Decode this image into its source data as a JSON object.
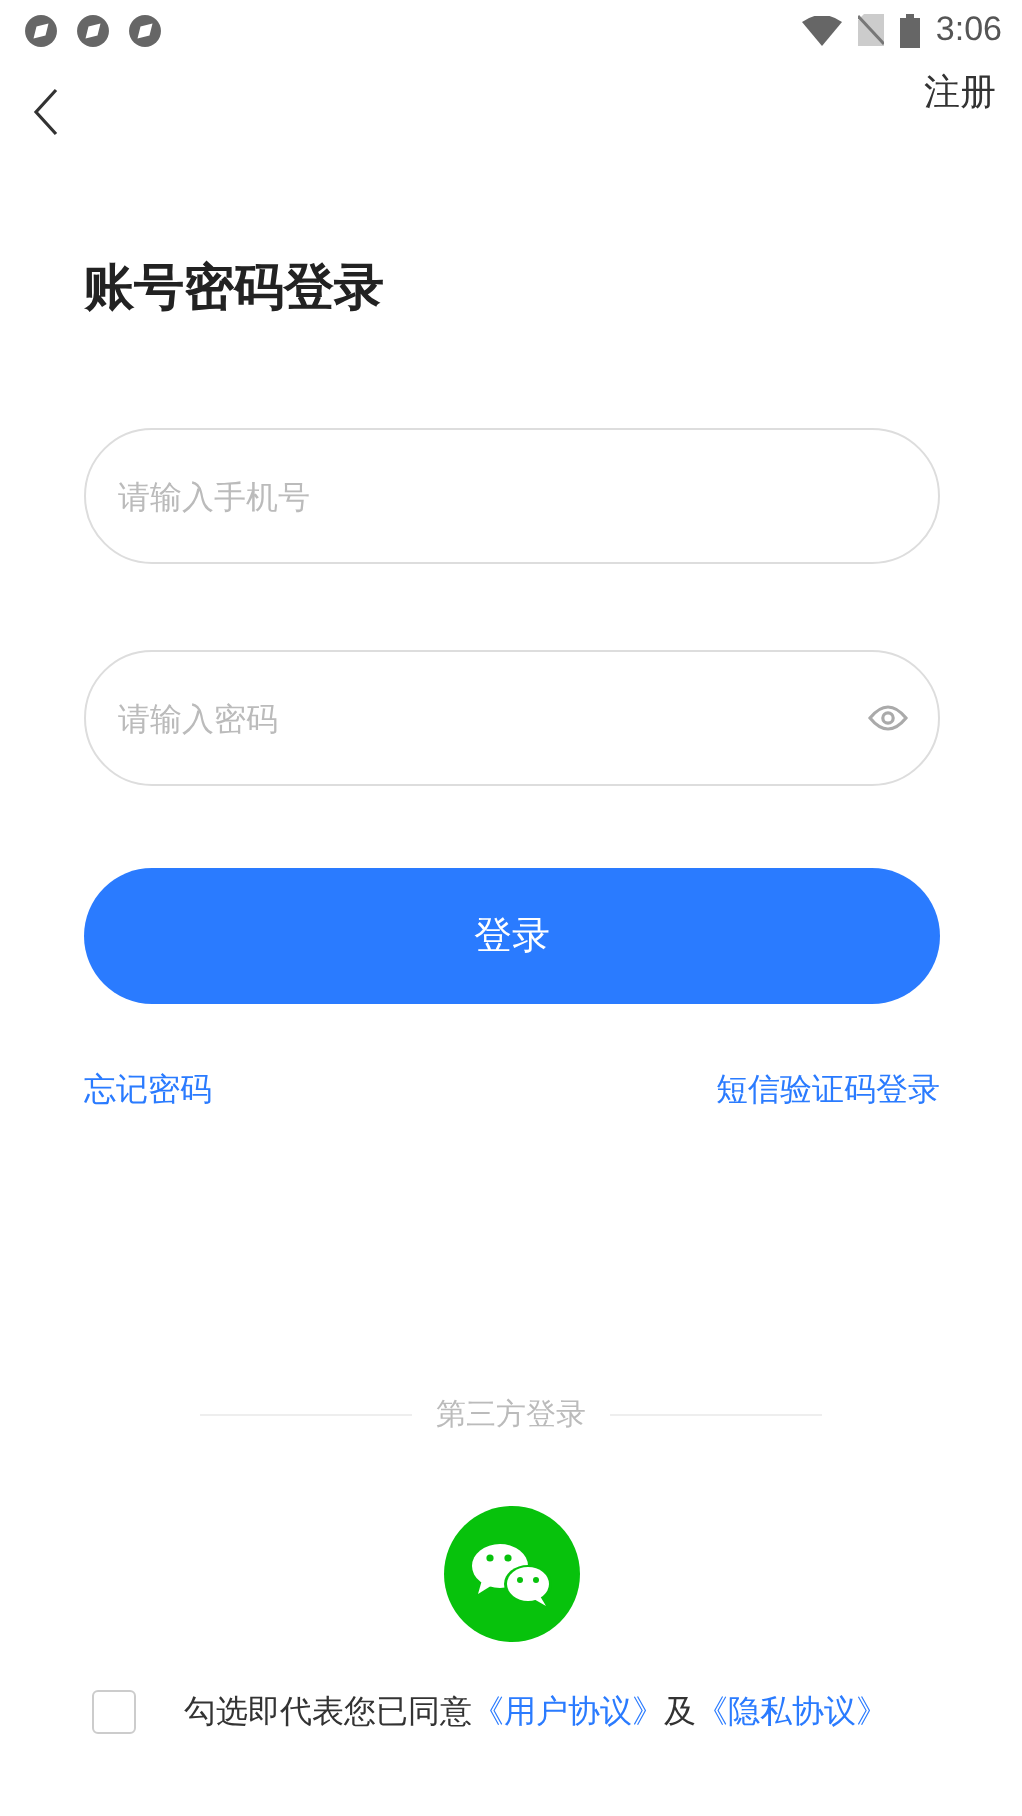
{
  "status_bar": {
    "time": "3:06"
  },
  "nav": {
    "action": "注册"
  },
  "title": "账号密码登录",
  "fields": [
    {
      "kind": "phone",
      "placeholder": "请输入手机号"
    },
    {
      "kind": "password",
      "placeholder": "请输入密码"
    }
  ],
  "login_button": "登录",
  "links": {
    "forgot": "忘记密码",
    "sms": "短信验证码登录"
  },
  "third_party": {
    "label": "第三方登录"
  },
  "agreement": {
    "checked": false,
    "text": "勾选即代表您已同意",
    "link1": "《用户协议》",
    "joiner": "及",
    "link2": "《隐私协议》"
  }
}
